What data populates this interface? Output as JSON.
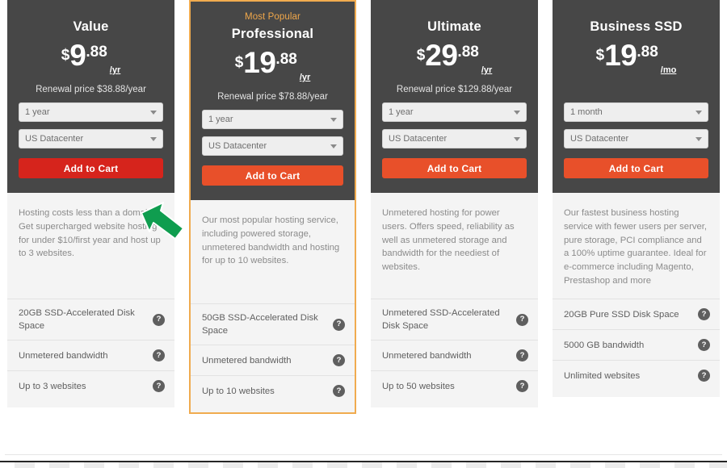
{
  "currency_symbol": "$",
  "badge_label": "Most Popular",
  "help_icon_glyph": "?",
  "colors": {
    "card_header_bg": "#474747",
    "card_body_bg": "#f4f4f4",
    "featured_border": "#f0ab4f",
    "badge_text": "#f0a74a",
    "cart_button": "#e8502a",
    "cart_button_hover": "#d6241c",
    "cursor_arrow": "#0f9d4f"
  },
  "cursor": {
    "icon": "arrow-cursor-up-left",
    "target": "add-to-cart-button-value"
  },
  "plans": [
    {
      "name": "Value",
      "badge": "",
      "featured": false,
      "price_whole": "9",
      "price_cents": ".88",
      "price_period": "/yr",
      "renewal": "Renewal price $38.88/year",
      "term_select": "1 year",
      "datacenter_select": "US Datacenter",
      "cart_label": "Add to Cart",
      "cart_hovered": true,
      "description": "Hosting costs less than a domain! Get supercharged website hosting for under $10/first year and host up to 3 websites.",
      "features": [
        "20GB SSD-Accelerated Disk Space",
        "Unmetered bandwidth",
        "Up to 3 websites"
      ]
    },
    {
      "name": "Professional",
      "badge": "Most Popular",
      "featured": true,
      "price_whole": "19",
      "price_cents": ".88",
      "price_period": "/yr",
      "renewal": "Renewal price $78.88/year",
      "term_select": "1 year",
      "datacenter_select": "US Datacenter",
      "cart_label": "Add to Cart",
      "cart_hovered": false,
      "description": "Our most popular hosting service, including powered storage, unmetered bandwidth and hosting for up to 10 websites.",
      "features": [
        "50GB SSD-Accelerated Disk Space",
        "Unmetered bandwidth",
        "Up to 10 websites"
      ]
    },
    {
      "name": "Ultimate",
      "badge": "",
      "featured": false,
      "price_whole": "29",
      "price_cents": ".88",
      "price_period": "/yr",
      "renewal": "Renewal price $129.88/year",
      "term_select": "1 year",
      "datacenter_select": "US Datacenter",
      "cart_label": "Add to Cart",
      "cart_hovered": false,
      "description": "Unmetered hosting for power users. Offers speed, reliability as well as unmetered storage and bandwidth for the neediest of websites.",
      "features": [
        "Unmetered SSD-Accelerated Disk Space",
        "Unmetered bandwidth",
        "Up to 50 websites"
      ]
    },
    {
      "name": "Business SSD",
      "badge": "",
      "featured": false,
      "price_whole": "19",
      "price_cents": ".88",
      "price_period": "/mo",
      "renewal": "",
      "term_select": "1 month",
      "datacenter_select": "US Datacenter",
      "cart_label": "Add to Cart",
      "cart_hovered": false,
      "description": "Our fastest business hosting service with fewer users per server, pure storage, PCI compliance and a 100% uptime guarantee. Ideal for e-commerce including Magento, Prestashop and more",
      "features": [
        "20GB Pure SSD Disk Space",
        "5000 GB bandwidth",
        "Unlimited websites"
      ]
    }
  ]
}
